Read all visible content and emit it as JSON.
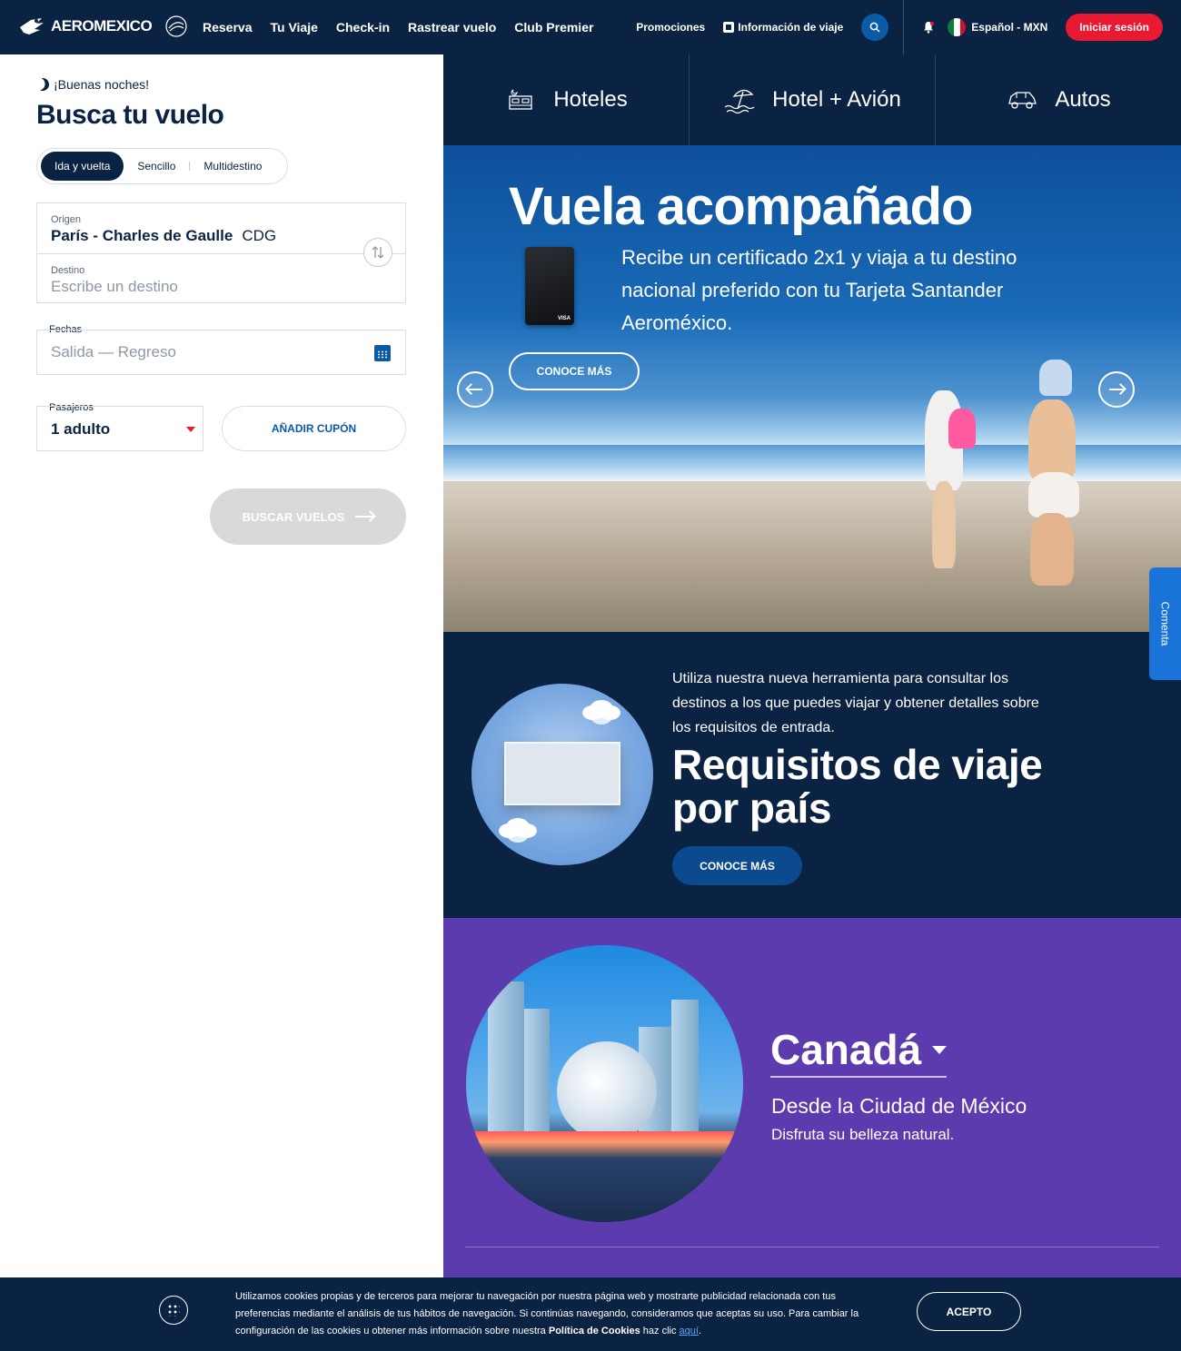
{
  "brand": {
    "logo_text": "AEROMEXICO",
    "skyteam_label": "SKYTEAM"
  },
  "nav": {
    "items": [
      {
        "label": "Reserva"
      },
      {
        "label": "Tu Viaje"
      },
      {
        "label": "Check-in"
      },
      {
        "label": "Rastrear vuelo"
      },
      {
        "label": "Club Premier"
      }
    ],
    "promotions": "Promociones",
    "travel_info": "Información de viaje",
    "language": "Español - MXN",
    "login": "Iniciar sesión"
  },
  "search": {
    "greeting": "¡Buenas noches!",
    "title": "Busca tu vuelo",
    "trip_types": [
      "Ida y vuelta",
      "Sencillo",
      "Multidestino"
    ],
    "selected_trip_type": "Ida y vuelta",
    "origin_label": "Origen",
    "origin_value": "París - Charles de Gaulle",
    "origin_code": "CDG",
    "destination_label": "Destino",
    "destination_placeholder": "Escribe un destino",
    "dates_label": "Fechas",
    "dates_placeholder": "Salida — Regreso",
    "passengers_label": "Pasajeros",
    "passengers_value": "1 adulto",
    "coupon": "AÑADIR CUPÓN",
    "submit": "BUSCAR VUELOS"
  },
  "tiles": [
    {
      "label": "Hoteles",
      "icon": "bed-icon"
    },
    {
      "label": "Hotel + Avión",
      "icon": "beach-umbrella-icon"
    },
    {
      "label": "Autos",
      "icon": "car-icon"
    }
  ],
  "hero": {
    "title": "Vuela acompañado",
    "text": "Recibe un certificado 2x1 y viaja a tu destino nacional preferido con tu Tarjeta Santander Aeroméxico.",
    "cta": "CONOCE MÁS"
  },
  "requirements": {
    "text": "Utiliza nuestra nueva herramienta para consultar los destinos a los que puedes viajar y obtener detalles sobre los requisitos de entrada.",
    "title": "Requisitos de viaje por país",
    "cta": "CONOCE MÁS"
  },
  "destination": {
    "name": "Canadá",
    "from": "Desde la Ciudad de México",
    "subtitle": "Disfruta su belleza natural."
  },
  "feedback": {
    "label": "Comenta"
  },
  "cookies": {
    "text_before": "Utilizamos cookies propias y de terceros para mejorar tu navegación por nuestra página web y mostrarte publicidad relacionada con tus preferencias mediante el análisis de tus hábitos de navegación. Si continúas navegando, consideramos que aceptas su uso. Para cambiar la configuración de las cookies u obtener más información sobre nuestra ",
    "policy": "Política de Cookies",
    "text_after": " haz clic ",
    "link": "aquí",
    "end": ".",
    "accept": "ACEPTO"
  },
  "colors": {
    "navy": "#0b2343",
    "accent_red": "#e91932",
    "blue": "#0b5aa6",
    "purple": "#5c3bae",
    "feedback_blue": "#1a73d9"
  }
}
